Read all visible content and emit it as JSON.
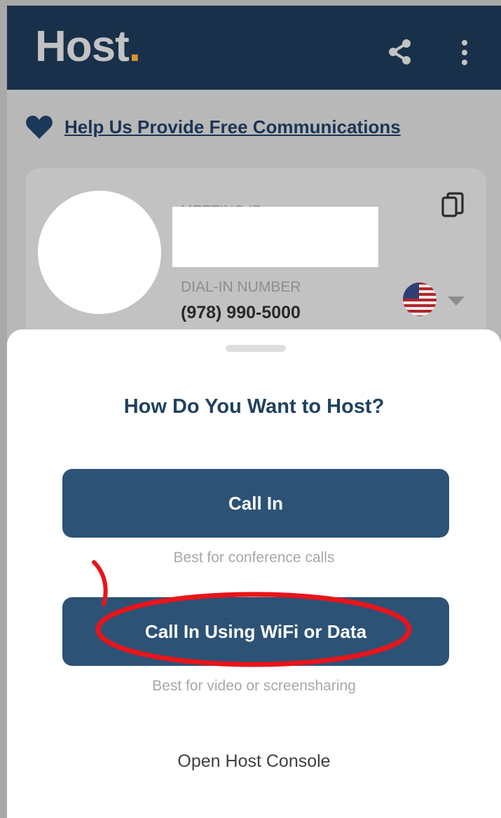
{
  "app": {
    "logo_text": "Host",
    "logo_dot": ".",
    "colors": {
      "topbar": "#183049",
      "accent_dot": "#d8922e",
      "button": "#2c5275",
      "annotation": "#e8141b"
    }
  },
  "toolbar": {
    "icons": [
      "share-icon",
      "more-vertical-icon"
    ]
  },
  "help": {
    "icon": "heart-icon",
    "link_text": "Help Us Provide Free Communications"
  },
  "meeting_card": {
    "meeting_id_label": "MEETING ID",
    "dial_in_label": "DIAL-IN NUMBER",
    "dial_in_number": "(978) 990-5000",
    "country_flag": "us-flag-icon",
    "copy_icon": "copy-icon"
  },
  "sheet": {
    "title": "How Do You Want to Host?",
    "options": [
      {
        "label": "Call In",
        "hint": "Best for conference calls"
      },
      {
        "label": "Call In Using WiFi or Data",
        "hint": "Best for video or screensharing"
      }
    ],
    "console_link": "Open Host Console"
  }
}
